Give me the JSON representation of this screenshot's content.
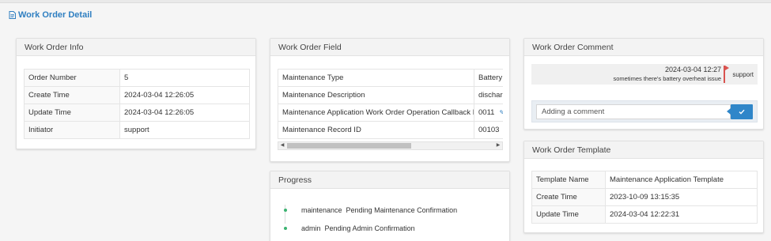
{
  "page": {
    "title": "Work Order Detail"
  },
  "info": {
    "title": "Work Order Info",
    "rows": [
      {
        "label": "Order Number",
        "value": "5"
      },
      {
        "label": "Create Time",
        "value": "2024-03-04 12:26:05"
      },
      {
        "label": "Update Time",
        "value": "2024-03-04 12:26:05"
      },
      {
        "label": "Initiator",
        "value": "support"
      }
    ]
  },
  "field": {
    "title": "Work Order Field",
    "rows": [
      {
        "label": "Maintenance Type",
        "value": "Battery"
      },
      {
        "label": "Maintenance Description",
        "value": "discharg"
      },
      {
        "label": "Maintenance Application Work Order Operation Callback ID",
        "value": "0011"
      },
      {
        "label": "Maintenance Record ID",
        "value": "00103"
      }
    ],
    "scroll_position": 0.0
  },
  "progress": {
    "title": "Progress",
    "items": [
      {
        "user": "maintenance",
        "status": "Pending Maintenance Confirmation"
      },
      {
        "user": "admin",
        "status": "Pending Admin Confirmation"
      }
    ]
  },
  "comment": {
    "title": "Work Order Comment",
    "entries": [
      {
        "time": "2024-03-04 12:27",
        "text": "sometimes there's battery overheat issue",
        "user": "support"
      }
    ],
    "input_placeholder": "Adding a comment",
    "input_value": ""
  },
  "template": {
    "title": "Work Order Template",
    "rows": [
      {
        "label": "Template Name",
        "value": "Maintenance Application Template"
      },
      {
        "label": "Create Time",
        "value": "2023-10-09 13:15:35"
      },
      {
        "label": "Update Time",
        "value": "2024-03-04 12:22:31"
      }
    ]
  },
  "colors": {
    "accent": "#2f7fc1",
    "progress_dot": "#3cb371",
    "comment_flag": "#d9534f",
    "send_button": "#2f86c9"
  }
}
